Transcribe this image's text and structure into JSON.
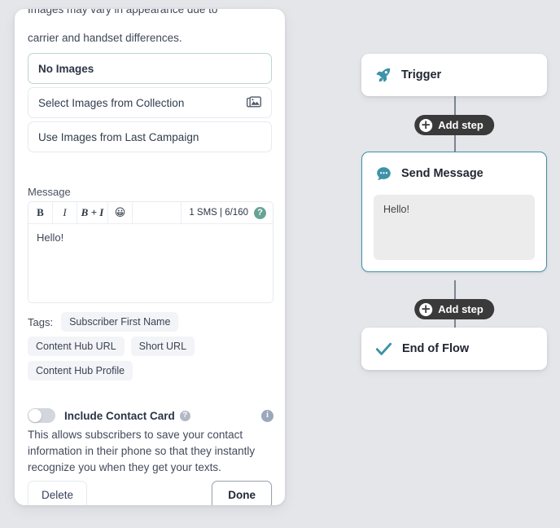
{
  "editor": {
    "clipped_text": "Images may vary in appearance due to",
    "description": "carrier and handset differences.",
    "image_options": [
      {
        "label": "No Images",
        "selected": true,
        "icon": ""
      },
      {
        "label": "Select Images from Collection",
        "selected": false,
        "icon": "image-icon"
      },
      {
        "label": "Use Images from Last Campaign",
        "selected": false,
        "icon": ""
      }
    ],
    "message": {
      "label": "Message",
      "toolbar": {
        "bold": "B",
        "italic": "I",
        "bold_italic": "B + I",
        "emoji": "😀",
        "counter": "1 SMS | 6/160",
        "help": "?"
      },
      "value": "Hello!"
    },
    "tags": {
      "caption": "Tags:",
      "items": [
        "Subscriber First Name",
        "Content Hub URL",
        "Short URL",
        "Content Hub Profile"
      ]
    },
    "contact_card": {
      "title": "Include Contact Card",
      "help": "?",
      "info": "i",
      "enabled": false,
      "description": "This allows subscribers to save your contact information in their phone so that they instantly recognize you when they get your texts."
    },
    "footer": {
      "delete_label": "Delete",
      "done_label": "Done"
    }
  },
  "flow": {
    "nodes": [
      {
        "title": "Trigger",
        "icon": "rocket-icon"
      },
      {
        "title": "Send Message",
        "icon": "chat-bubble-icon",
        "preview": "Hello!",
        "selected": true
      },
      {
        "title": "End of Flow",
        "icon": "check-icon"
      }
    ],
    "add_step_label": "Add step",
    "add_step_icon": "plus-circle-icon"
  },
  "colors": {
    "background": "#e5e6ea",
    "accent_teal": "#3d92a8",
    "help_green": "#67a395",
    "info_blue": "#9aa7bd",
    "addstep_dark": "#3a3a3a"
  }
}
